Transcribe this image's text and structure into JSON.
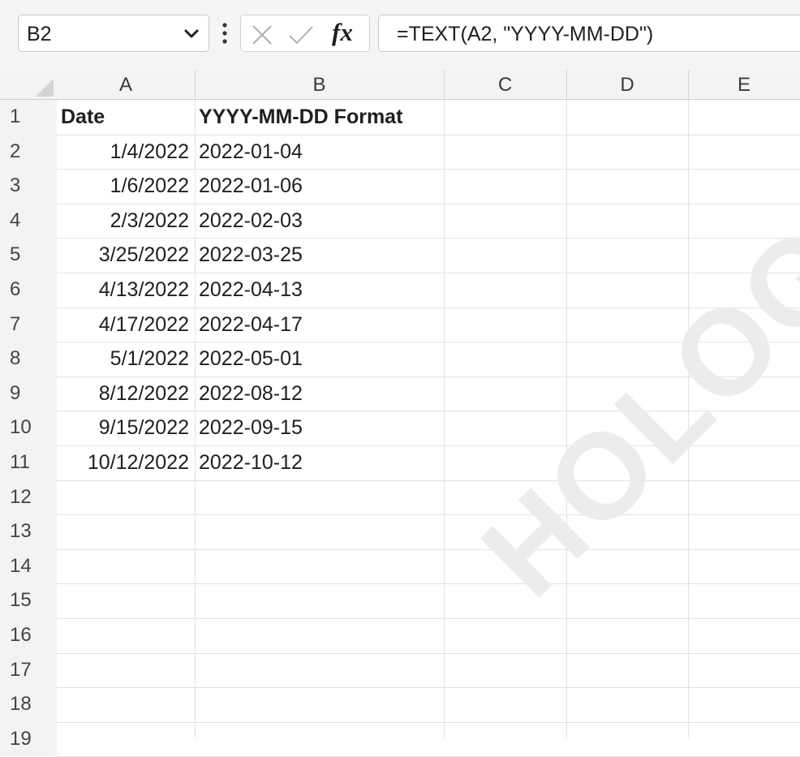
{
  "name_box": {
    "value": "B2"
  },
  "formula_bar": {
    "fx_label": "fx",
    "formula": "=TEXT(A2, \"YYYY-MM-DD\")"
  },
  "columns": [
    "A",
    "B",
    "C",
    "D",
    "E"
  ],
  "rows": [
    "1",
    "2",
    "3",
    "4",
    "5",
    "6",
    "7",
    "8",
    "9",
    "10",
    "11",
    "12",
    "13",
    "14",
    "15",
    "16",
    "17",
    "18",
    "19"
  ],
  "cells": {
    "A1": "Date",
    "B1": "YYYY-MM-DD Format",
    "A2": "1/4/2022",
    "B2": "2022-01-04",
    "A3": "1/6/2022",
    "B3": "2022-01-06",
    "A4": "2/3/2022",
    "B4": "2022-02-03",
    "A5": "3/25/2022",
    "B5": "2022-03-25",
    "A6": "4/13/2022",
    "B6": "2022-04-13",
    "A7": "4/17/2022",
    "B7": "2022-04-17",
    "A8": "5/1/2022",
    "B8": "2022-05-01",
    "A9": "8/12/2022",
    "B9": "2022-08-12",
    "A10": "9/15/2022",
    "B10": "2022-09-15",
    "A11": "10/12/2022",
    "B11": "2022-10-12"
  },
  "watermark": "HOLOGY.C",
  "icons": {
    "namebox_dropdown": "chevron-down-icon",
    "more": "vertical-dots-icon",
    "cancel": "close-icon",
    "enter": "check-icon",
    "function": "fx-icon"
  }
}
